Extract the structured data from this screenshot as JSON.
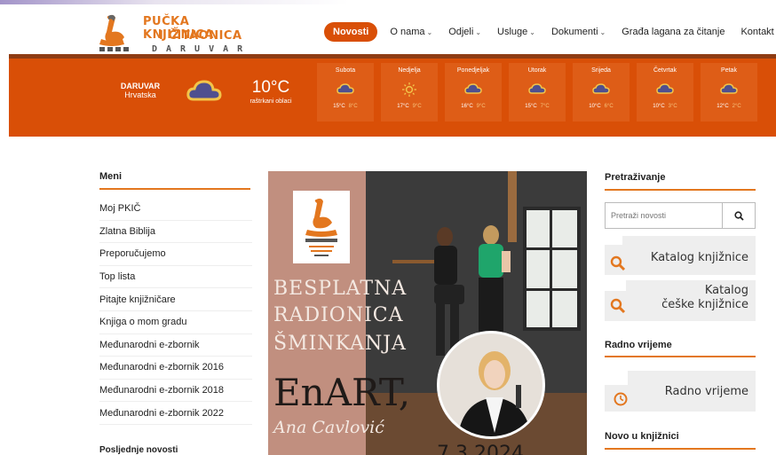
{
  "logo": {
    "line1": "PUČKA KNJIŽNICA",
    "line2": "I ČITAONICA",
    "line3": "DARUVAR"
  },
  "nav": {
    "items": [
      {
        "label": "Novosti",
        "active": true,
        "dropdown": false
      },
      {
        "label": "O nama",
        "active": false,
        "dropdown": true
      },
      {
        "label": "Odjeli",
        "active": false,
        "dropdown": true
      },
      {
        "label": "Usluge",
        "active": false,
        "dropdown": true
      },
      {
        "label": "Dokumenti",
        "active": false,
        "dropdown": true
      },
      {
        "label": "Građa lagana za čitanje",
        "active": false,
        "dropdown": false
      },
      {
        "label": "Kontakt",
        "active": false,
        "dropdown": false
      }
    ],
    "chevron": "⌄"
  },
  "weather": {
    "city": "DARUVAR",
    "country": "Hrvatska",
    "temp": "10°C",
    "description": "raštrkani oblaci",
    "icon": "cloud-icon",
    "days": [
      {
        "name": "Subota",
        "icon": "cloud-icon",
        "high": "15°C",
        "low": "8°C"
      },
      {
        "name": "Nedjelja",
        "icon": "sun-icon",
        "high": "17°C",
        "low": "9°C"
      },
      {
        "name": "Ponedjeljak",
        "icon": "cloud-icon",
        "high": "16°C",
        "low": "9°C"
      },
      {
        "name": "Utorak",
        "icon": "cloud-icon",
        "high": "15°C",
        "low": "7°C"
      },
      {
        "name": "Srijeda",
        "icon": "cloud-icon",
        "high": "10°C",
        "low": "6°C"
      },
      {
        "name": "Četvrtak",
        "icon": "cloud-icon",
        "high": "10°C",
        "low": "3°C"
      },
      {
        "name": "Petak",
        "icon": "cloud-icon",
        "high": "12°C",
        "low": "2°C"
      }
    ]
  },
  "menu": {
    "title": "Meni",
    "items": [
      "Moj PKIČ",
      "Zlatna Biblija",
      "Preporučujemo",
      "Top lista",
      "Pitajte knjižničare",
      "Knjiga o mom gradu",
      "Međunarodni e-zbornik",
      "Međunarodni e-zbornik 2016",
      "Međunarodni e-zbornik 2018",
      "Međunarodni e-zbornik 2022"
    ],
    "news_title": "Posljednje novosti"
  },
  "banner": {
    "line1": "BESPLATNA",
    "line2": "RADIONICA",
    "line3": "ŠMINKANJA",
    "line4": "EnART,",
    "line5": "Ana Cavlović",
    "date": "7.3.2024."
  },
  "sidebar": {
    "search_title": "Pretraživanje",
    "search_placeholder": "Pretraži novosti",
    "catalog1": "Katalog knjižnice",
    "catalog2_l1": "Katalog",
    "catalog2_l2": "češke knjižnice",
    "hours_title": "Radno vrijeme",
    "hours_link": "Radno vrijeme",
    "new_title": "Novo u knjižnici"
  },
  "colors": {
    "accent": "#d94f07",
    "brand_orange": "#e3771f"
  }
}
